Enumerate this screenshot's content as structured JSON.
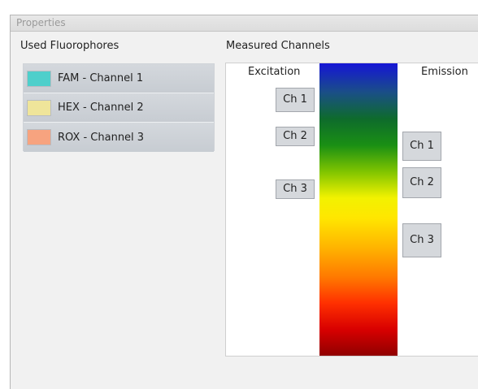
{
  "window": {
    "title": "Properties"
  },
  "fluorophores": {
    "heading": "Used Fluorophores",
    "items": [
      {
        "label": "FAM - Channel 1",
        "color": "#4ecfcb"
      },
      {
        "label": "HEX - Channel 2",
        "color": "#efe59a"
      },
      {
        "label": "ROX - Channel 3",
        "color": "#f7a37f"
      }
    ]
  },
  "channels": {
    "heading": "Measured Channels",
    "excitation_label": "Excitation",
    "emission_label": "Emission",
    "excitation": [
      "Ch 1",
      "Ch 2",
      "Ch 3"
    ],
    "emission": [
      "Ch 1",
      "Ch 2",
      "Ch 3"
    ]
  }
}
